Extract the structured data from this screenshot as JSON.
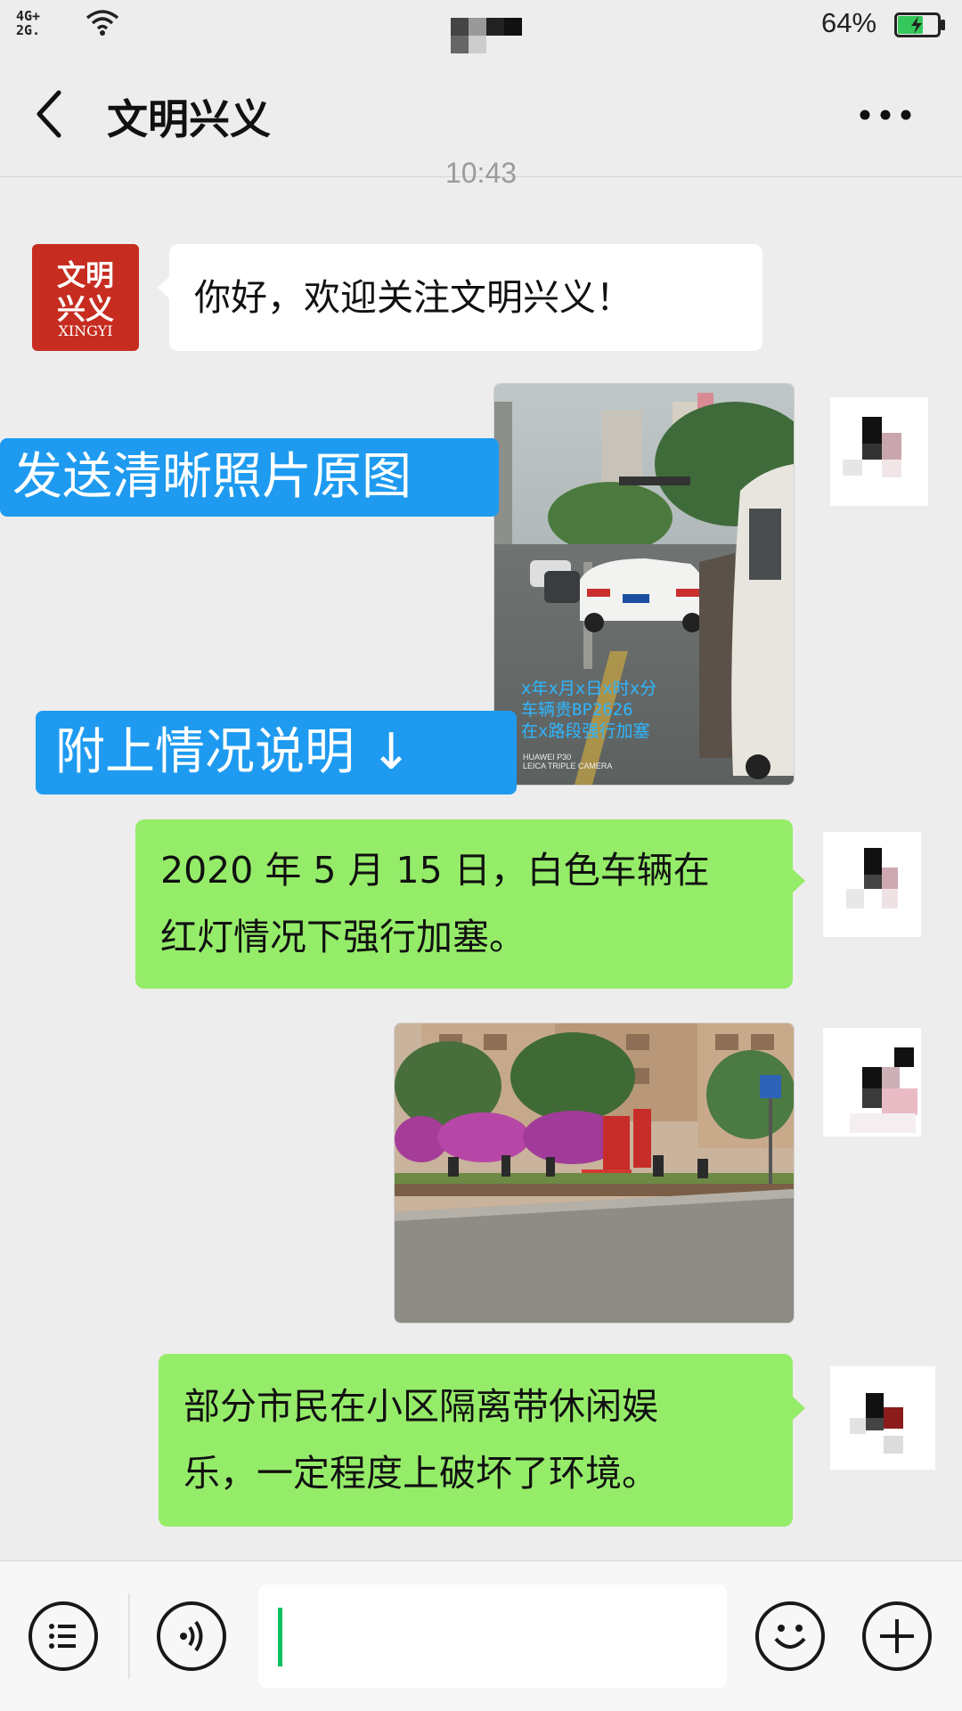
{
  "status_bar": {
    "network": "4G+\n2G.",
    "battery_percent": "64%",
    "battery_level": 0.64,
    "battery_color": "#34c759"
  },
  "nav": {
    "title": "文明兴义",
    "back_icon": "chevron-left-icon",
    "more_icon": "more-dots-icon"
  },
  "timestamp": "10:43",
  "avatar_logo": {
    "line1": "文明",
    "line2": "兴义",
    "line3": "XINGYI",
    "color": "#c62d20"
  },
  "messages": {
    "welcome": "你好，欢迎关注文明兴义！",
    "photo1_caption": "x年x月x日x时x分\n车辆贵BP2626\n在x路段强行加塞",
    "photo1_camera": "HUAWEI P30\nLEICA TRIPLE CAMERA",
    "report1_line1": "2020 年 5 月 15 日，白色车辆在",
    "report1_line2": "红灯情况下强行加塞。",
    "report2_line1": "部分市民在小区隔离带休闲娱",
    "report2_line2": "乐，一定程度上破坏了环境。"
  },
  "overlays": {
    "send_photo": "发送清晰照片原图",
    "attach_desc": "附上情况说明 ↓"
  },
  "colors": {
    "bubble_green": "#95ec69",
    "overlay_blue": "#1e9bf0",
    "caret_green": "#07c160"
  }
}
